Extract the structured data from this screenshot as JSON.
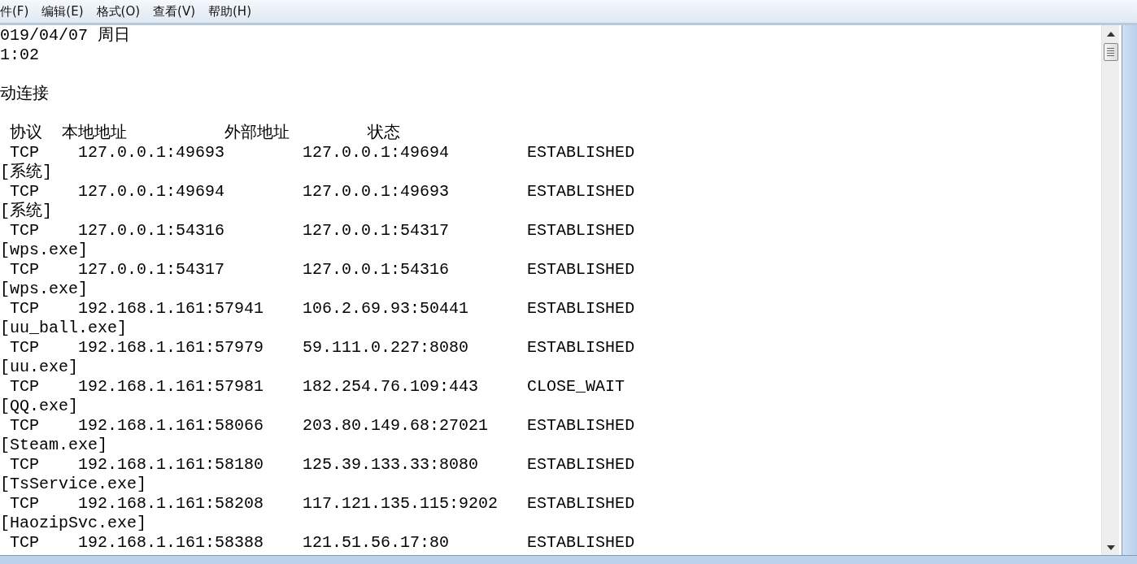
{
  "menu_bar": {
    "items": [
      "件(F)",
      "编辑(E)",
      "格式(O)",
      "查看(V)",
      "帮助(H)"
    ]
  },
  "document": {
    "blocks": [
      [
        "019/04/07 周日",
        "1:02"
      ],
      [
        "动连接"
      ],
      [
        " 协议  本地地址          外部地址        状态",
        " TCP    127.0.0.1:49693        127.0.0.1:49694        ESTABLISHED",
        "[系统]",
        " TCP    127.0.0.1:49694        127.0.0.1:49693        ESTABLISHED",
        "[系统]",
        " TCP    127.0.0.1:54316        127.0.0.1:54317        ESTABLISHED",
        "[wps.exe]",
        " TCP    127.0.0.1:54317        127.0.0.1:54316        ESTABLISHED",
        "[wps.exe]",
        " TCP    192.168.1.161:57941    106.2.69.93:50441      ESTABLISHED",
        "[uu_ball.exe]",
        " TCP    192.168.1.161:57979    59.111.0.227:8080      ESTABLISHED",
        "[uu.exe]",
        " TCP    192.168.1.161:57981    182.254.76.109:443     CLOSE_WAIT",
        "[QQ.exe]",
        " TCP    192.168.1.161:58066    203.80.149.68:27021    ESTABLISHED",
        "[Steam.exe]",
        " TCP    192.168.1.161:58180    125.39.133.33:8080     ESTABLISHED",
        "[TsService.exe]",
        " TCP    192.168.1.161:58208    117.121.135.115:9202   ESTABLISHED",
        "[HaozipSvc.exe]",
        " TCP    192.168.1.161:58388    121.51.56.17:80        ESTABLISHED"
      ]
    ]
  }
}
